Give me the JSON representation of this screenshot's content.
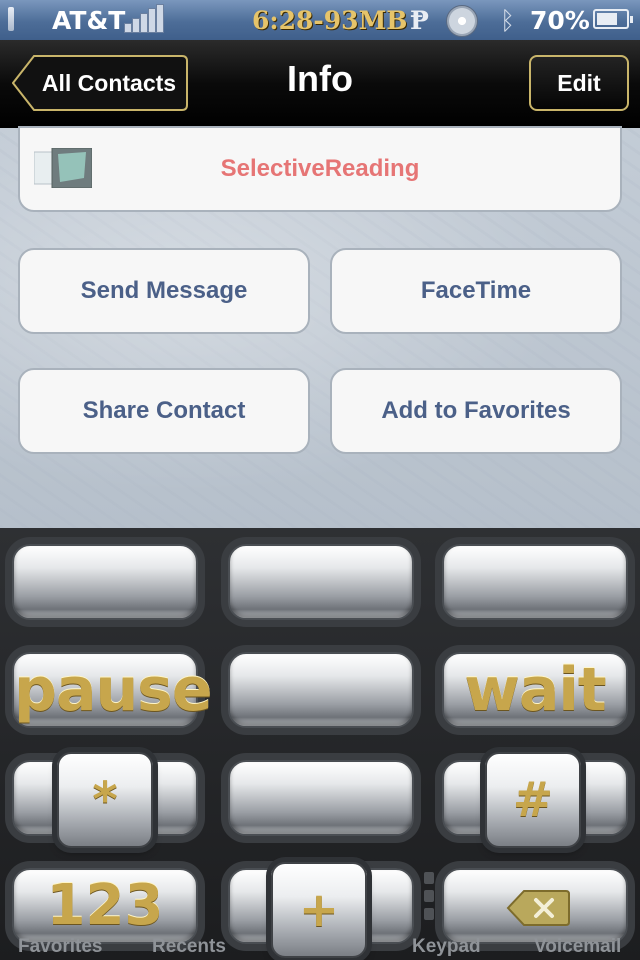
{
  "status_bar": {
    "carrier": "AT&T",
    "time_memory": "6:28-93MB",
    "p_icon": "Ᵽ",
    "bluetooth_icon": "bluetooth-icon",
    "battery_percent": "70%",
    "battery_level": 0.7
  },
  "nav": {
    "back_label": "All Contacts",
    "title": "Info",
    "edit_label": "Edit"
  },
  "linked_app": {
    "label": "SelectiveReading",
    "icon": "app-thumbnail-icon"
  },
  "actions": {
    "send_message": "Send Message",
    "facetime": "FaceTime",
    "share_contact": "Share Contact",
    "add_favorites": "Add to Favorites"
  },
  "keypad": {
    "pause": "pause",
    "wait": "wait",
    "star": "*",
    "hash": "#",
    "numbers": "123",
    "plus": "+",
    "delete_icon": "backspace-icon"
  },
  "tabbar": {
    "favorites": "Favorites",
    "recents": "Recents",
    "keypad": "Keypad",
    "voicemail": "Voicemail"
  },
  "colors": {
    "accent_blue": "#4b6088",
    "app_label": "#e67575",
    "gold_text": "#c7a64c"
  }
}
